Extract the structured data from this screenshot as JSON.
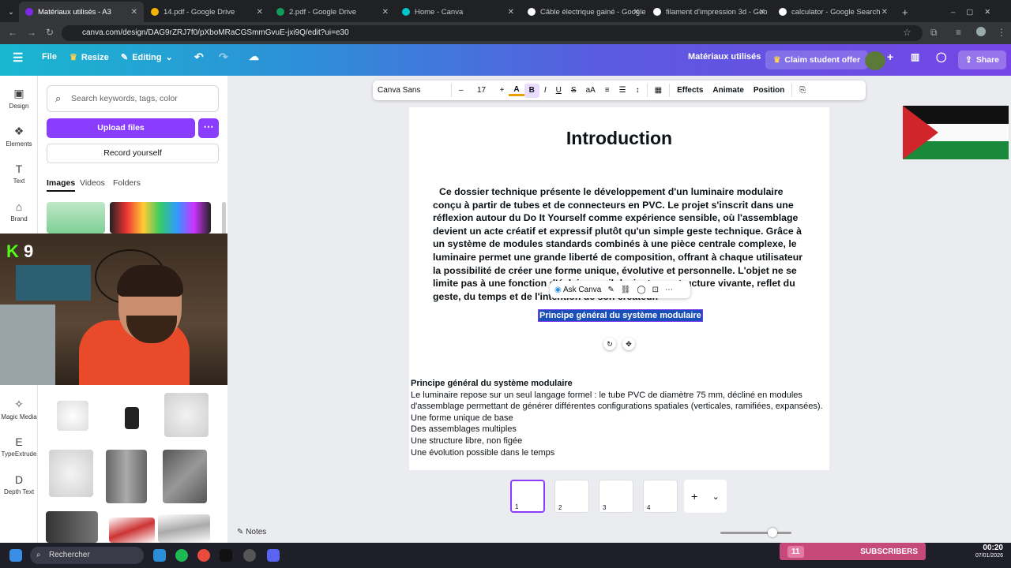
{
  "browser": {
    "tabs": [
      {
        "label": "Matériaux utilisés - A3",
        "active": true
      },
      {
        "label": "14.pdf - Google Drive"
      },
      {
        "label": "2.pdf - Google Drive"
      },
      {
        "label": "Home - Canva"
      },
      {
        "label": "Câble électrique gainé - Google"
      },
      {
        "label": "filament d'impression 3d - Goo"
      },
      {
        "label": "calculator - Google Search"
      }
    ],
    "url": "canva.com/design/DAG9rZRJ7f0/pXboMRaCGSmmGvuE-jxi9Q/edit?ui=e30"
  },
  "header": {
    "file": "File",
    "resize": "Resize",
    "editing": "Editing",
    "doc_title": "Matériaux utilisés",
    "claim": "Claim student offer",
    "share": "Share"
  },
  "rail": {
    "design": "Design",
    "elements": "Elements",
    "text": "Text",
    "brand": "Brand",
    "magic_media": "Magic Media",
    "typeextrude": "TypeExtrude",
    "depth_text": "Depth Text"
  },
  "panel": {
    "search_placeholder": "Search keywords, tags, color",
    "upload": "Upload files",
    "record": "Record yourself",
    "tabs": [
      "Images",
      "Videos",
      "Folders"
    ]
  },
  "webcam": {
    "overlay": "9"
  },
  "text_toolbar": {
    "font": "Canva Sans",
    "size": "17",
    "minus": "–",
    "plus": "+",
    "effects": "Effects",
    "animate": "Animate",
    "position": "Position"
  },
  "document": {
    "title": "Introduction",
    "paragraph": "Ce dossier technique présente le développement d'un luminaire modulaire conçu à partir de tubes et de connecteurs en PVC. Le projet s'inscrit dans une réflexion autour du Do It Yourself comme expérience sensible, où l'assemblage devient un acte créatif et expressif plutôt qu'un simple geste technique. Grâce à un système de modules standards combinés à une pièce centrale complexe, le luminaire permet une grande liberté de composition, offrant à chaque utilisateur la possibilité de créer une forme unique, évolutive et personnelle. L'objet ne se limite pas à une fonction d'éclairage : il devient une structure vivante, reflet du geste, du temps et de l'intention de son créateur.",
    "ask_canva": "Ask Canva",
    "selected_text": "Principe général du système modulaire",
    "section_heading": "Principe général du système modulaire",
    "section_body": "Le luminaire repose sur un seul langage formel : le tube PVC de diamètre 75 mm, décliné en modules d'assemblage permettant de générer différentes configurations spatiales (verticales, ramifiées, expansées).",
    "bullets": [
      "Une forme unique de base",
      "Des assemblages multiples",
      "Une structure libre, non figée",
      "Une évolution possible dans le temps"
    ]
  },
  "pages": {
    "numbers": [
      "1",
      "2",
      "3",
      "4"
    ],
    "add": "+",
    "notes": "Notes"
  },
  "taskbar": {
    "search": "Rechercher",
    "subscribers_count": "11",
    "subscribers": "SUBSCRIBERS",
    "time": "00:20",
    "date": "07/01/2026"
  }
}
